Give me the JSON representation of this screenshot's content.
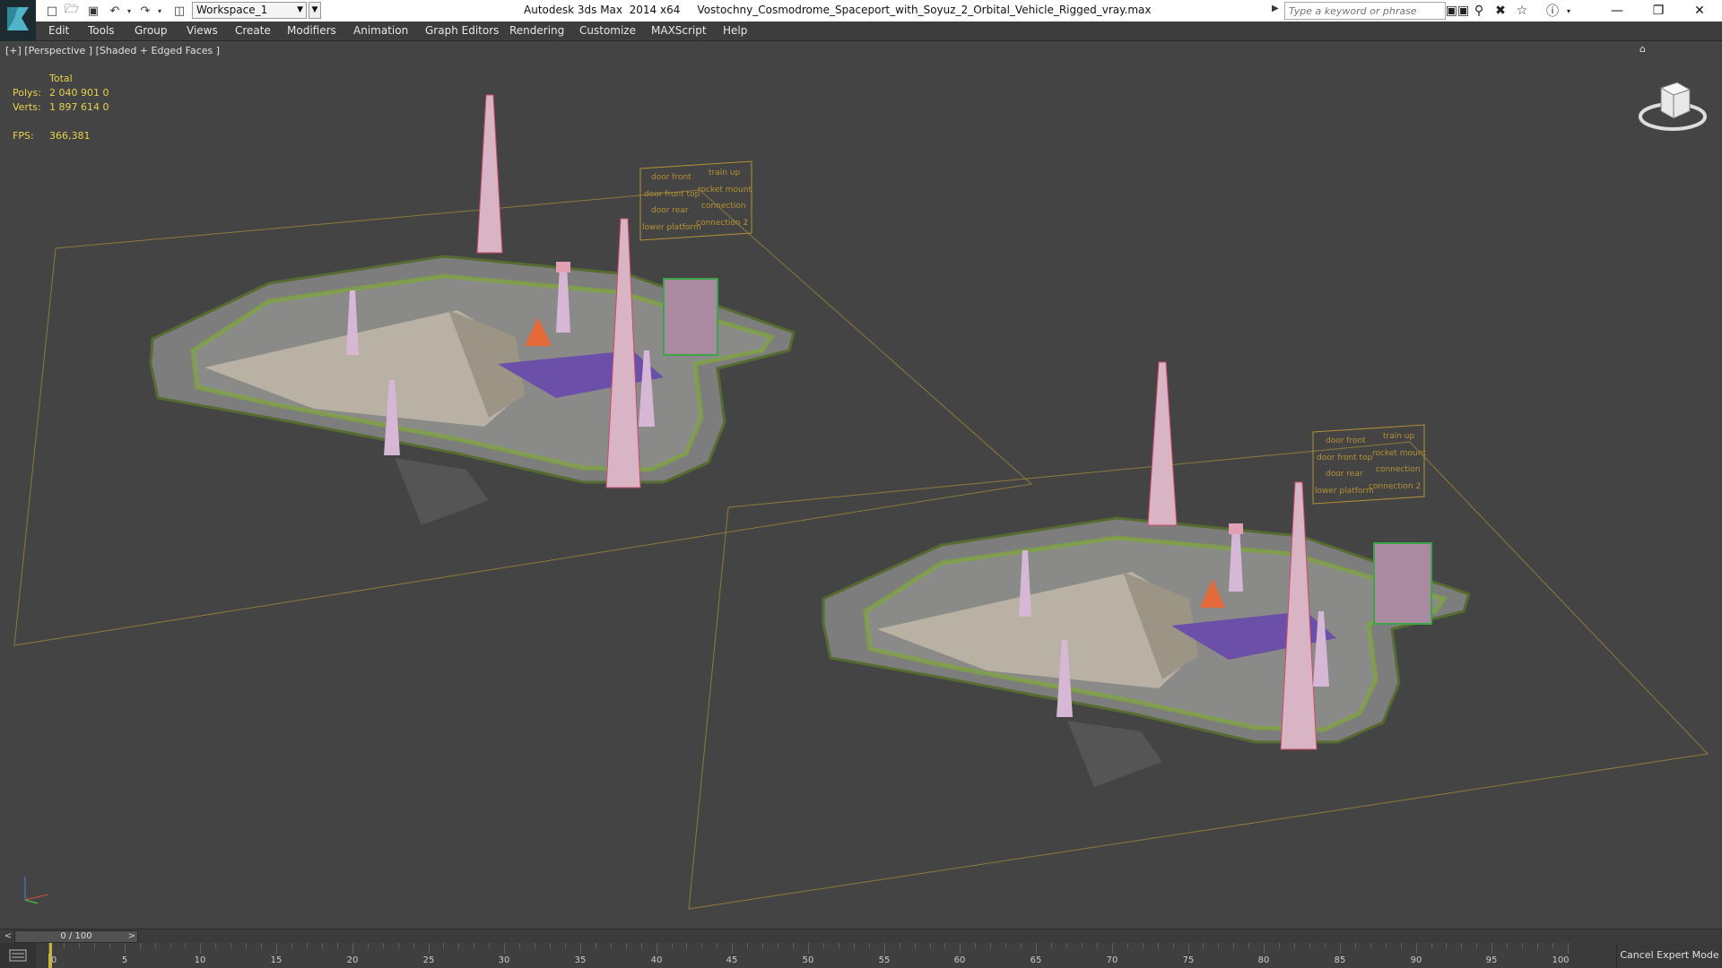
{
  "titlebar": {
    "app_icon": "3ds-max-logo-icon",
    "quick_access": [
      "new-file-icon",
      "open-file-icon",
      "save-icon",
      "undo-icon",
      "redo-icon",
      "project-folder-icon"
    ],
    "workspace": "Workspace_1",
    "title": "Autodesk 3ds Max  2014 x64     Vostochny_Cosmodrome_Spaceport_with_Soyuz_2_Orbital_Vehicle_Rigged_vray.max",
    "search_placeholder": "Type a keyword or phrase",
    "toolbar_icons": [
      "binoculars-icon",
      "key-tool-icon",
      "communication-center-icon",
      "favorites-star-icon",
      "help-icon"
    ],
    "window_controls": [
      "minimize-icon",
      "restore-icon",
      "close-icon"
    ]
  },
  "menu": [
    "Edit",
    "Tools",
    "Group",
    "Views",
    "Create",
    "Modifiers",
    "Animation",
    "Graph Editors",
    "Rendering",
    "Customize",
    "MAXScript",
    "Help"
  ],
  "viewport": {
    "label": "[+] [Perspective ] [Shaded + Edged Faces ]",
    "stats": {
      "header": "Total",
      "polys_label": "Polys:",
      "polys_value": "2 040 901   0",
      "verts_label": "Verts:",
      "verts_value": "1 897 614   0",
      "fps_label": "FPS:",
      "fps_value": "366,381"
    },
    "control_panel_labels": [
      "door front",
      "train up",
      "door front top",
      "rocket mount",
      "door rear",
      "connection",
      "lower platform",
      "connection 2"
    ]
  },
  "timeslider": {
    "position_label": "0 / 100",
    "prev": "<",
    "next": ">"
  },
  "trackbar": {
    "ticks": [
      "0",
      "5",
      "10",
      "15",
      "20",
      "25",
      "30",
      "35",
      "40",
      "45",
      "50",
      "55",
      "60",
      "65",
      "70",
      "75",
      "80",
      "85",
      "90",
      "95",
      "100"
    ],
    "cancel_expert": "Cancel Expert Mode"
  }
}
